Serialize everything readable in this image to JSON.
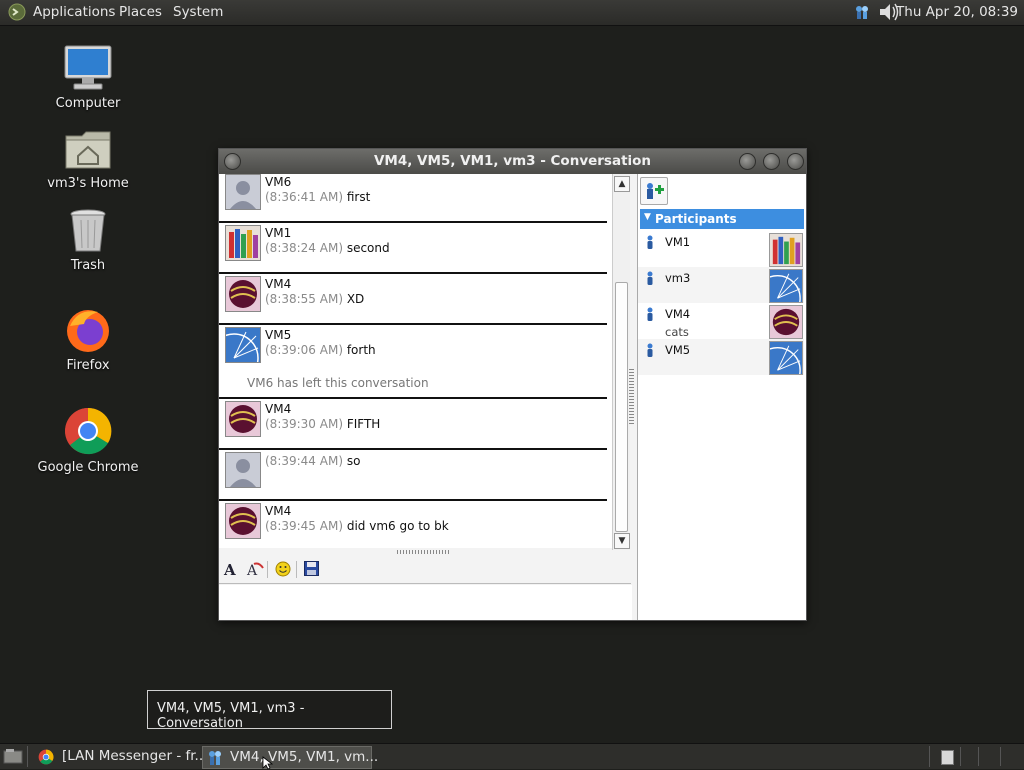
{
  "top_panel": {
    "menus": [
      "Applications",
      "Places",
      "System"
    ],
    "clock": "Thu Apr 20, 08:39",
    "icons": [
      "distro-logo-icon",
      "network-users-icon",
      "volume-icon"
    ]
  },
  "desktop": {
    "icons": [
      {
        "label": "Computer",
        "icon": "computer-icon"
      },
      {
        "label": "vm3's Home",
        "icon": "home-folder-icon"
      },
      {
        "label": "Trash",
        "icon": "trash-icon"
      },
      {
        "label": "Firefox",
        "icon": "firefox-icon"
      },
      {
        "label": "Google Chrome",
        "icon": "chrome-icon"
      }
    ]
  },
  "window": {
    "title": "VM4, VM5, VM1, vm3 - Conversation",
    "messages": [
      {
        "sender": "VM6",
        "time": "(8:36:41 AM)",
        "text": "first",
        "avatar": "default-user-avatar"
      },
      {
        "sender": "VM1",
        "time": "(8:38:24 AM)",
        "text": "second",
        "avatar": "crayons-avatar"
      },
      {
        "sender": "VM4",
        "time": "(8:38:55 AM)",
        "text": "XD",
        "avatar": "sphere-avatar"
      },
      {
        "sender": "VM5",
        "time": "(8:39:06 AM)",
        "text": "forth",
        "avatar": "ferris-wheel-avatar"
      },
      {
        "sender": "VM4",
        "time": "(8:39:30 AM)",
        "text": "FIFTH",
        "avatar": "sphere-avatar"
      },
      {
        "sender": "",
        "time": "(8:39:44 AM)",
        "text": "so",
        "avatar": "default-user-avatar"
      },
      {
        "sender": "VM4",
        "time": "(8:39:45 AM)",
        "text": "did vm6 go to bk",
        "avatar": "sphere-avatar"
      }
    ],
    "system_message": "VM6 has left this conversation",
    "toolbar": [
      "font-icon",
      "font-color-icon",
      "smiley-icon",
      "save-icon"
    ],
    "input_value": "",
    "participants_header": "Participants",
    "participants": [
      {
        "name": "VM1",
        "status": "",
        "avatar": "crayons-avatar"
      },
      {
        "name": "vm3",
        "status": "",
        "avatar": "ferris-wheel-avatar"
      },
      {
        "name": "VM4",
        "status": "cats",
        "avatar": "sphere-avatar"
      },
      {
        "name": "VM5",
        "status": "",
        "avatar": "ferris-wheel-avatar"
      }
    ]
  },
  "tooltip": "VM4, VM5, VM1, vm3 - Conversation",
  "taskbar": {
    "tasks": [
      {
        "label": "[LAN Messenger - fr...",
        "icon": "chrome-icon"
      },
      {
        "label": "VM4, VM5, VM1, vm...",
        "icon": "lan-messenger-icon"
      }
    ]
  },
  "colors": {
    "desktop_bg": "#1e1f1c",
    "participants_header": "#3d8ee0",
    "timestamp": "#8a8a8a"
  }
}
